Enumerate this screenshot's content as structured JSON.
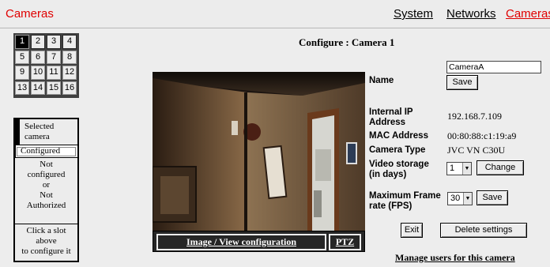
{
  "app_title": "Cameras",
  "nav": {
    "system": "System",
    "networks": "Networks",
    "cameras": "Cameras"
  },
  "slots": [
    "1",
    "2",
    "3",
    "4",
    "5",
    "6",
    "7",
    "8",
    "9",
    "10",
    "11",
    "12",
    "13",
    "14",
    "15",
    "16"
  ],
  "selected_slot": "1",
  "legend": {
    "selected_line1": "Selected",
    "selected_line2": "camera",
    "configured": "Configured",
    "not_configured_lines": [
      "Not",
      "configured",
      "or",
      "Not",
      "Authorized"
    ],
    "hint_lines": [
      "Click a slot",
      "above",
      "to configure it"
    ]
  },
  "page_title": "Configure : Camera 1",
  "camera_view": {
    "image_config_link": "Image / View configuration",
    "ptz_link": "PTZ"
  },
  "form": {
    "name_label": "Name",
    "name_value": "CameraA",
    "name_save": "Save",
    "ip_label_1": "Internal IP",
    "ip_label_2": "Address",
    "ip_value": "192.168.7.109",
    "mac_label": "MAC Address",
    "mac_value": "00:80:88:c1:19:a9",
    "type_label": "Camera Type",
    "type_value": "JVC VN C30U",
    "storage_label_1": "Video storage",
    "storage_label_2": "(in days)",
    "storage_value": "1",
    "storage_change": "Change",
    "fps_label_1": "Maximum Frame",
    "fps_label_2": "rate (FPS)",
    "fps_value": "30",
    "fps_save": "Save",
    "exit": "Exit",
    "delete": "Delete settings"
  },
  "manage_users_link": "Manage users for this camera"
}
